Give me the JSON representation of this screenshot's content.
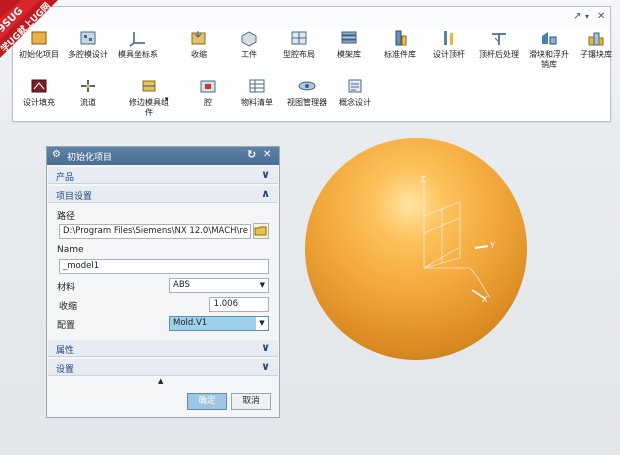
{
  "watermark": {
    "line1": "9SUG",
    "line2": "学UG就上UG网"
  },
  "toolbar": {
    "pin_glyph": "↗",
    "dropdown_glyph": "▾",
    "close_glyph": "✕",
    "more_glyph": "▾",
    "row1": [
      {
        "label": "初始化项目",
        "icon": "init-project-icon"
      },
      {
        "label": "多腔模设计",
        "icon": "multi-cavity-icon"
      },
      {
        "label": "模具坐标系",
        "icon": "mold-csys-icon"
      },
      {
        "label": "收缩",
        "icon": "shrink-icon"
      },
      {
        "label": "工件",
        "icon": "workpiece-icon"
      },
      {
        "label": "型腔布局",
        "icon": "cavity-layout-icon"
      },
      {
        "label": "模架库",
        "icon": "mold-base-icon"
      },
      {
        "label": "标准件库",
        "icon": "standard-part-icon"
      },
      {
        "label": "设计顶杆",
        "icon": "ejector-pin-icon"
      },
      {
        "label": "顶杆后处理",
        "icon": "ejector-post-icon"
      },
      {
        "label": "滑块和浮升",
        "sublabel": "销库",
        "icon": "slider-lifter-icon"
      },
      {
        "label": "子镶块库",
        "icon": "sub-insert-icon"
      }
    ],
    "row2": [
      {
        "label": "设计填充",
        "icon": "fill-design-icon"
      },
      {
        "label": "流道",
        "icon": "runner-icon"
      },
      {
        "label": "修边模具组",
        "sublabel": "件",
        "icon": "trim-tool-icon"
      },
      {
        "label": "腔",
        "icon": "pocket-icon"
      },
      {
        "label": "物料清单",
        "icon": "bom-icon"
      },
      {
        "label": "视图管理器",
        "icon": "view-manager-icon"
      },
      {
        "label": "概念设计",
        "icon": "concept-design-icon"
      }
    ]
  },
  "dialog": {
    "title": "初始化项目",
    "reset_glyph": "↻",
    "close_glyph": "✕",
    "sections": {
      "product": "产品",
      "project_settings": "项目设置",
      "properties": "属性",
      "settings": "设置"
    },
    "path_label": "路径",
    "path_value": "D:\\Program Files\\Siemens\\NX 12.0\\MACH\\re",
    "name_label": "Name",
    "name_value": "_model1",
    "material_label": "材料",
    "material_value": "ABS",
    "shrink_label": "收缩",
    "shrink_value": "1.006",
    "config_label": "配置",
    "config_value": "Mold.V1",
    "expand_glyph": "▲",
    "ok_label": "确定",
    "cancel_label": "取消",
    "chevron_down": "∨",
    "chevron_up": "∧",
    "dd_glyph": "▼"
  },
  "csys": {
    "axis_x": "X",
    "axis_y": "Y",
    "axis_z": "Z"
  }
}
